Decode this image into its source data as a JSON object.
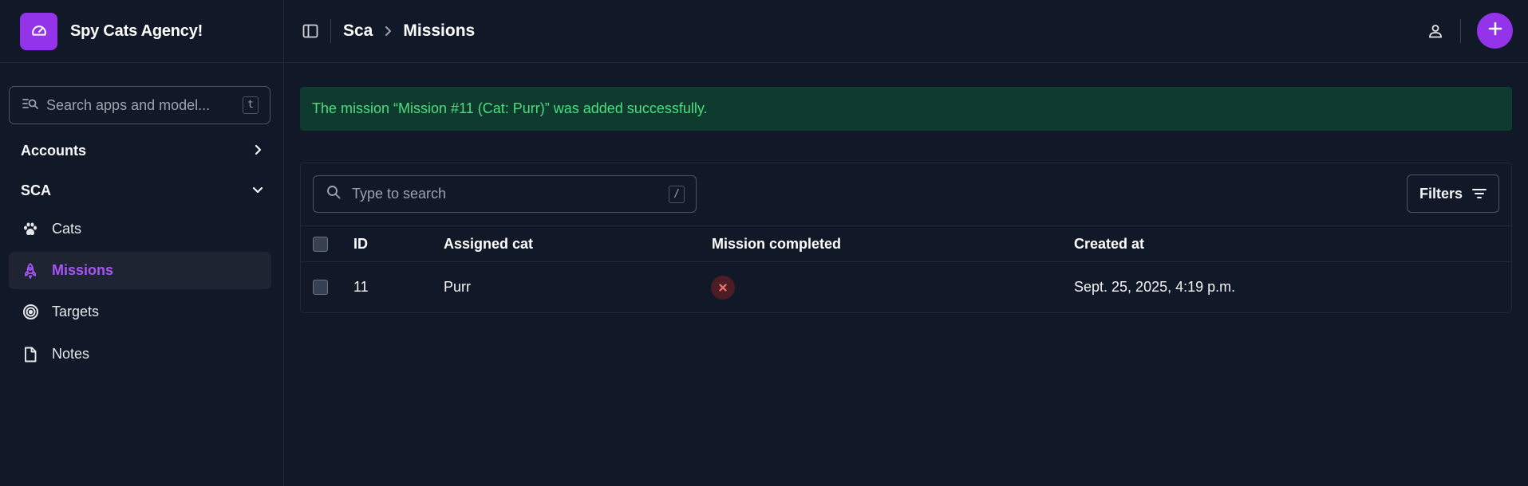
{
  "brand": {
    "title": "Spy Cats Agency!",
    "logo_icon": "gauge-icon",
    "accent": "#9333ea"
  },
  "sidebar": {
    "search": {
      "placeholder": "Search apps and model...",
      "shortcut": "t"
    },
    "sections": [
      {
        "label": "Accounts",
        "state": "collapsed"
      },
      {
        "label": "SCA",
        "state": "expanded"
      }
    ],
    "items": [
      {
        "label": "Cats",
        "icon": "paw-icon",
        "active": false
      },
      {
        "label": "Missions",
        "icon": "rocket-icon",
        "active": true
      },
      {
        "label": "Targets",
        "icon": "target-icon",
        "active": false
      },
      {
        "label": "Notes",
        "icon": "file-icon",
        "active": false
      }
    ]
  },
  "header": {
    "breadcrumb": [
      "Sca",
      "Missions"
    ]
  },
  "alert": {
    "message": "The mission “Mission #11 (Cat: Purr)” was added successfully.",
    "color": "#4ade80"
  },
  "table": {
    "search": {
      "placeholder": "Type to search",
      "shortcut": "/"
    },
    "filters_label": "Filters",
    "columns": [
      "ID",
      "Assigned cat",
      "Mission completed",
      "Created at"
    ],
    "rows": [
      {
        "id": "11",
        "assigned_cat": "Purr",
        "mission_completed": false,
        "created_at": "Sept. 25, 2025, 4:19 p.m."
      }
    ]
  }
}
